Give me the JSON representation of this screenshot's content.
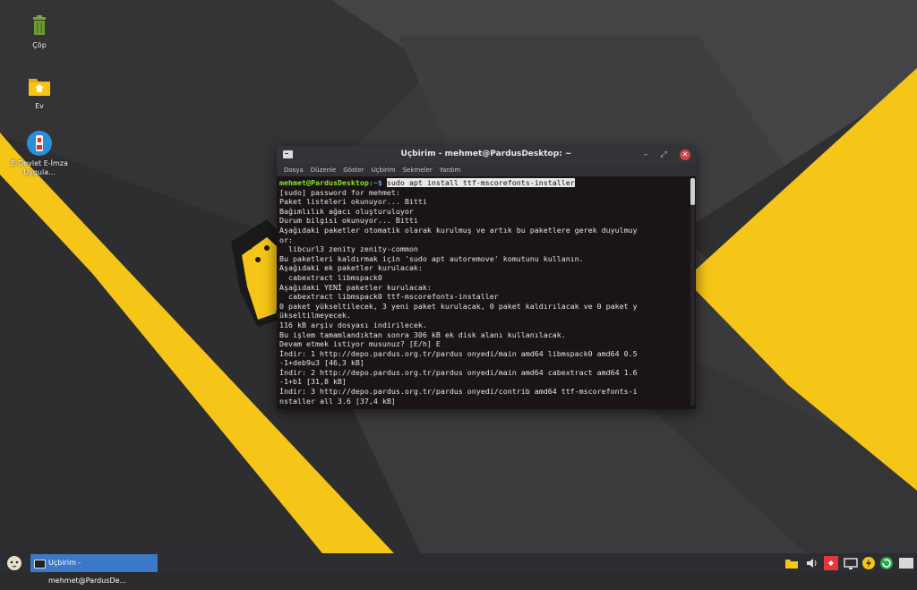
{
  "desktop": {
    "icons": [
      {
        "label": "Çöp",
        "icon": "trash-icon"
      },
      {
        "label": "Ev",
        "icon": "home-folder-icon"
      },
      {
        "label": "E-Devlet E-İmza Uygula...",
        "icon": "usb-token-icon"
      }
    ]
  },
  "terminal": {
    "title": "Uçbirim - mehmet@PardusDesktop: ~",
    "menu": [
      "Dosya",
      "Düzenle",
      "Göster",
      "Uçbirim",
      "Sekmeler",
      "Yardım"
    ],
    "prompt_user": "mehmet@PardusDesktop",
    "prompt_path": ":~$",
    "command": "sudo apt install ttf-mscorefonts-installer",
    "output": [
      "[sudo] password for mehmet:",
      "Paket listeleri okunuyor... Bitti",
      "Bağımlılık ağacı oluşturuluyor",
      "Durum bilgisi okunuyor... Bitti",
      "Aşağıdaki paketler otomatik olarak kurulmuş ve artık bu paketlere gerek duyulmuy",
      "or:",
      "  libcurl3 zenity zenity-common",
      "Bu paketleri kaldırmak için 'sudo apt autoremove' komutunu kullanın.",
      "Aşağıdaki ek paketler kurulacak:",
      "  cabextract libmspack0",
      "Aşağıdaki YENİ paketler kurulacak:",
      "  cabextract libmspack0 ttf-mscorefonts-installer",
      "0 paket yükseltilecek, 3 yeni paket kurulacak, 0 paket kaldırılacak ve 0 paket y",
      "ükseltilmeyecek.",
      "116 kB arşiv dosyası indirilecek.",
      "Bu işlem tamamlandıktan sonra 306 kB ek disk alanı kullanılacak.",
      "Devam etmek istiyor musunuz? [E/h] E",
      "İndir: 1 http://depo.pardus.org.tr/pardus onyedi/main amd64 libmspack0 amd64 0.5",
      "-1+deb9u3 [46,3 kB]",
      "İndir: 2 http://depo.pardus.org.tr/pardus onyedi/main amd64 cabextract amd64 1.6",
      "-1+b1 [31,8 kB]",
      "İndir: 3 http://depo.pardus.org.tr/pardus onyedi/contrib amd64 ttf-mscorefonts-i",
      "nstaller all 3.6 [37,4 kB]"
    ]
  },
  "taskbar": {
    "task_label": "Uçbirim - mehmet@PardusDe...",
    "tray_icons": [
      "folder-icon",
      "volume-icon",
      "anydesk-icon",
      "display-icon",
      "power-icon",
      "update-icon",
      "show-desktop-icon"
    ]
  },
  "colors": {
    "accent_yellow": "#f5c518",
    "task_blue": "#3c78c8",
    "prompt_green": "#8ae234",
    "prompt_blue": "#729fcf"
  }
}
